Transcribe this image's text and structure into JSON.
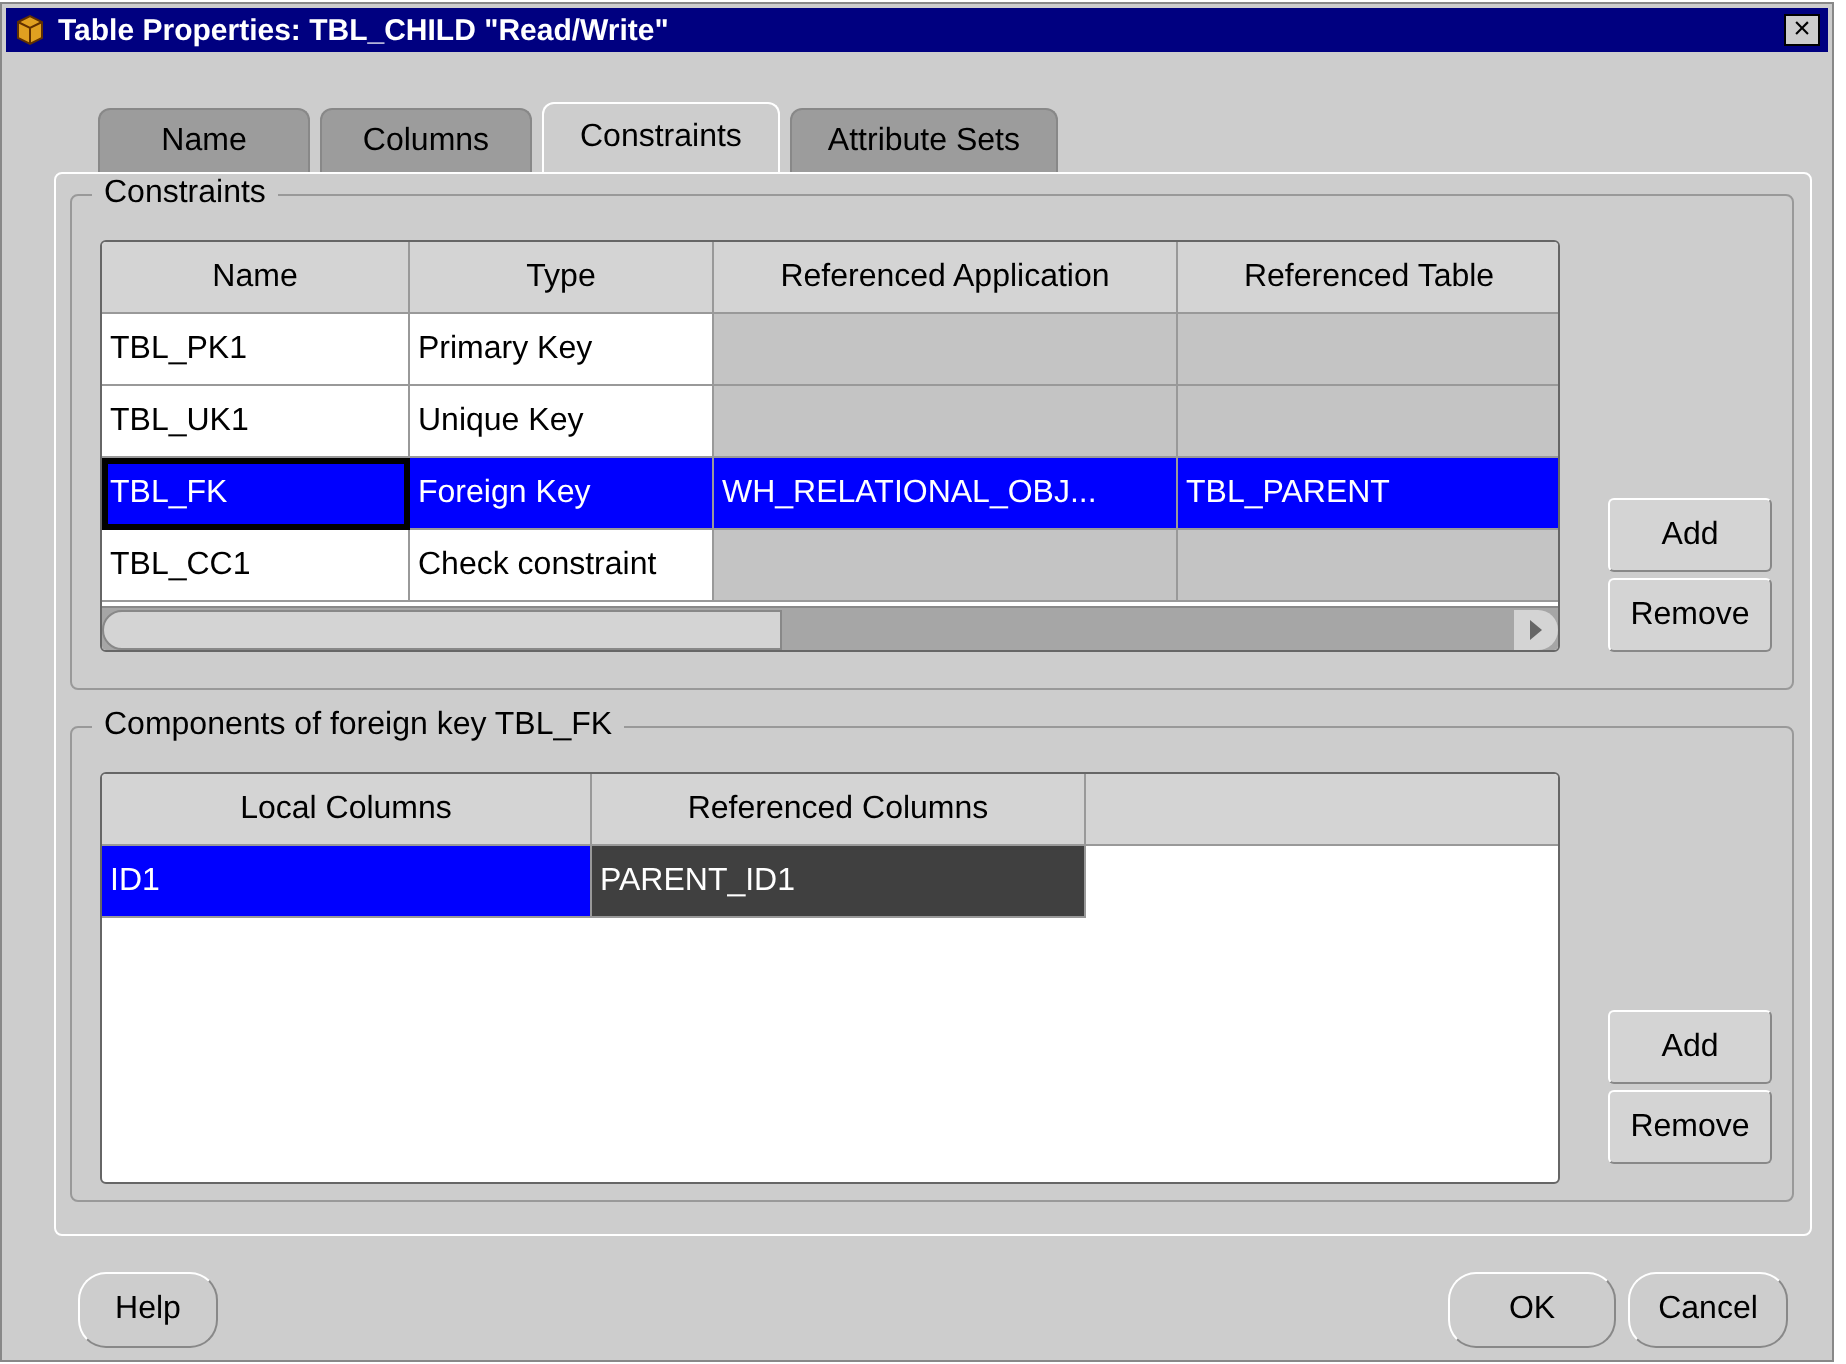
{
  "window": {
    "title": "Table Properties: TBL_CHILD \"Read/Write\"",
    "close": "×"
  },
  "tabs": [
    {
      "label": "Name",
      "selected": false
    },
    {
      "label": "Columns",
      "selected": false
    },
    {
      "label": "Constraints",
      "selected": true
    },
    {
      "label": "Attribute Sets",
      "selected": false
    }
  ],
  "constraints": {
    "title": "Constraints",
    "columns": [
      "Name",
      "Type",
      "Referenced Application",
      "Referenced Table"
    ],
    "rows": [
      {
        "name": "TBL_PK1",
        "type": "Primary Key",
        "selected": false,
        "focused": false
      },
      {
        "name": "TBL_UK1",
        "type": "Unique Key",
        "selected": false,
        "focused": false
      },
      {
        "name": "TBL_FK",
        "type": "Foreign Key",
        "application": "WH_RELATIONAL_OBJ...",
        "table": "TBL_PARENT",
        "selected": true,
        "focused": true
      },
      {
        "name": "TBL_CC1",
        "type": "Check constraint",
        "selected": false,
        "focused": false
      }
    ],
    "buttons": [
      "Add",
      "Remove"
    ]
  },
  "components": {
    "title": "Components of foreign key TBL_FK",
    "columns": [
      "Local Columns",
      "Referenced Columns"
    ],
    "rows": [
      {
        "selected": true,
        "cells": [
          {
            "text": "ID1",
            "active": true
          },
          {
            "text": "PARENT_ID1",
            "active": false
          }
        ]
      }
    ],
    "buttons": [
      "Add",
      "Remove"
    ]
  },
  "footer": {
    "help": "Help",
    "ok": "OK",
    "cancel": "Cancel"
  }
}
